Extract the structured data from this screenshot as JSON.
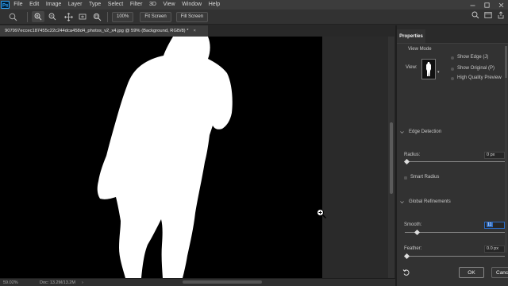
{
  "menubar": {
    "items": [
      "File",
      "Edit",
      "Image",
      "Layer",
      "Type",
      "Select",
      "Filter",
      "3D",
      "View",
      "Window",
      "Help"
    ],
    "logo_icon": "photoshop-logo-icon",
    "window_controls": [
      "minimize-icon",
      "maximize-icon",
      "close-icon"
    ]
  },
  "options": {
    "zoom_value": "100%",
    "fit_screen": "Fit Screen",
    "fill_screen": "Fill Screen",
    "tool_icons": [
      "zoom-tool-icon",
      "zoom-in-icon",
      "zoom-out-icon",
      "move-icon",
      "hand-icon",
      "zoom-search-icon"
    ],
    "right_icons": [
      "search-icon",
      "workspace-icon",
      "share-icon"
    ]
  },
  "document": {
    "tab_title": "907997eccec187455c22c244dca458d4_photos_v2_x4.jpg @ 59% (Background, RGB/8) *",
    "tab_close": "×"
  },
  "status": {
    "zoom": "59.02%",
    "doc_info": "Doc: 13.2M/13.2M",
    "arrow": "›"
  },
  "properties": {
    "tab_label": "Properties",
    "view_mode_label": "View Mode",
    "view_label": "View:",
    "show_edge": "Show Edge (J)",
    "show_original": "Show Original (P)",
    "high_quality": "High Quality Preview",
    "edge_detection": "Edge Detection",
    "radius_label": "Radius:",
    "radius_value": "0 px",
    "smart_radius": "Smart Radius",
    "global_refinements": "Global Refinements",
    "smooth_label": "Smooth:",
    "smooth_value": "11",
    "feather_label": "Feather:",
    "feather_value": "0.0 px",
    "ok": "OK",
    "cancel": "Cancel",
    "reset_icon": "reset-icon"
  },
  "colors": {
    "canvas": "#000000",
    "subject": "#ffffff",
    "accent": "#2c6ac0"
  }
}
